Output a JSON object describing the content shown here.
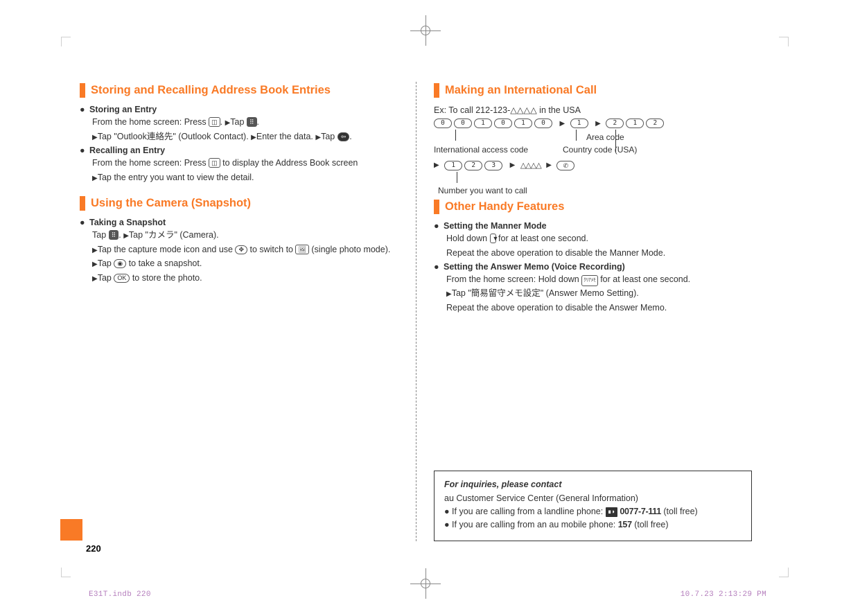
{
  "left": {
    "h1": "Storing and Recalling Address Book Entries",
    "s1": {
      "title": "Storing an Entry",
      "l1a": "From the home screen: Press ",
      "l1b": ". ",
      "l1c": "Tap ",
      "l1d": ".",
      "l2a": "Tap \"Outlook連絡先\" (Outlook Contact). ",
      "l2b": "Enter the data. ",
      "l2c": "Tap ",
      "l2d": "."
    },
    "s2": {
      "title": "Recalling an Entry",
      "l1a": "From the home screen: Press ",
      "l1b": " to display the Address Book screen",
      "l2": "Tap the entry you want to view the detail."
    },
    "h2": "Using the Camera (Snapshot)",
    "s3": {
      "title": "Taking a Snapshot",
      "l1a": "Tap ",
      "l1b": ". ",
      "l1c": "Tap \"カメラ\" (Camera).",
      "l2a": "Tap the capture mode icon and use ",
      "l2b": " to switch to ",
      "l2c": " (single photo mode).",
      "l3a": "Tap ",
      "l3b": " to take a snapshot.",
      "l4a": "Tap ",
      "l4b": " to store the photo."
    }
  },
  "right": {
    "h1": "Making an International Call",
    "ex": "Ex: To call 212-123-△△△△ in the USA",
    "keys1": [
      "0",
      "0",
      "1",
      "0",
      "1",
      "0"
    ],
    "keys1b": [
      "1"
    ],
    "keys1c": [
      "2",
      "1",
      "2"
    ],
    "label_area": "Area code",
    "label_intl": "International access code",
    "label_country": "Country code (USA)",
    "keys2": [
      "1",
      "2",
      "3"
    ],
    "label_number": "Number you want to call",
    "h2": "Other Handy Features",
    "s1": {
      "title": "Setting the Manner Mode",
      "l1a": "Hold down ",
      "l1b": " for at least one second.",
      "l2": "Repeat the above operation to disable the Manner Mode."
    },
    "s2": {
      "title": "Setting the Answer Memo (Voice Recording)",
      "l1a": "From the home screen: Hold down ",
      "l1b": " for at least one second.",
      "l2": "Tap \"簡易留守メモ設定\" (Answer Memo Setting).",
      "l3": "Repeat the above operation to disable the Answer Memo."
    },
    "contact": {
      "title": "For inquiries, please contact",
      "sub": "au Customer Service Center (General Information)",
      "l1a": "If you are calling from a landline phone: ",
      "tel1": "0077-7-111",
      "l1b": " (toll free)",
      "l2a": "If you are calling from an au mobile phone: ",
      "tel2": "157",
      "l2b": " (toll free)"
    }
  },
  "pagenum": "220",
  "footer_left": "E31T.indb   220",
  "footer_right": "10.7.23   2:13:29 PM"
}
